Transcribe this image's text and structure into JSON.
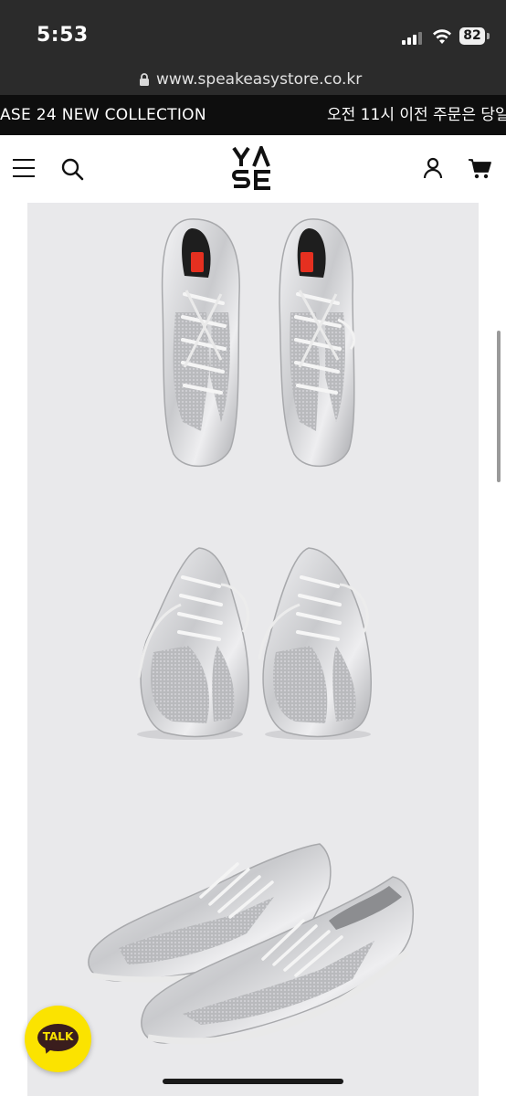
{
  "status_bar": {
    "time": "5:53",
    "battery": "82"
  },
  "url_bar": {
    "url": "www.speakeasystore.co.kr"
  },
  "announcement": {
    "left_text": "ASE 24 NEW COLLECTION",
    "right_text": "오전 11시 이전 주문은 당일"
  },
  "header": {
    "logo_text": "YASE",
    "menu_icon": "hamburger-icon",
    "search_icon": "search-icon",
    "account_icon": "account-icon",
    "cart_icon": "cart-icon"
  },
  "product_images": [
    {
      "name": "sneakers-top-view"
    },
    {
      "name": "sneakers-front-view"
    },
    {
      "name": "sneakers-side-view"
    }
  ],
  "chat_button": {
    "label": "TALK",
    "color": "#fbe300"
  },
  "colors": {
    "status_bg": "#2b2b2b",
    "announcement_bg": "#0e0e0e",
    "content_bg": "#e9e9eb",
    "accent_red": "#e53020"
  }
}
